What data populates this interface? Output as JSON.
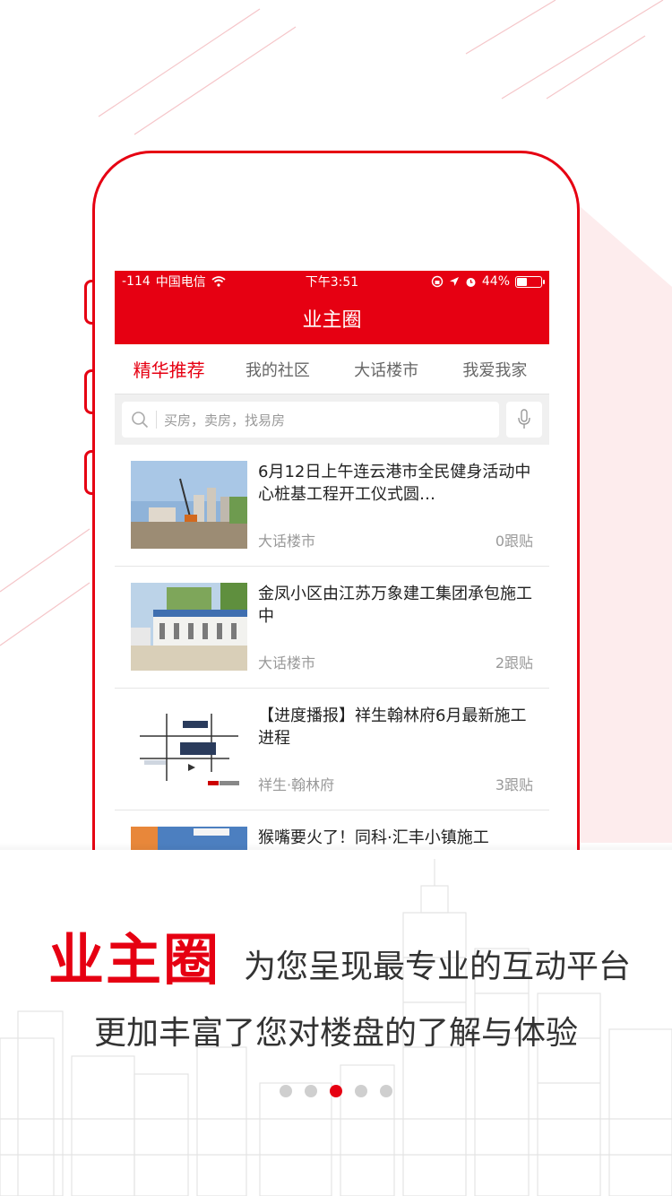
{
  "status_bar": {
    "signal": "-114",
    "carrier": "中国电信",
    "time": "下午3:51",
    "battery_percent": "44%",
    "battery_level": 0.44
  },
  "navbar": {
    "title": "业主圈"
  },
  "tabs": [
    {
      "label": "精华推荐",
      "active": true
    },
    {
      "label": "我的社区",
      "active": false
    },
    {
      "label": "大话楼市",
      "active": false
    },
    {
      "label": "我爱我家",
      "active": false
    }
  ],
  "search": {
    "placeholder": "买房，卖房，找易房"
  },
  "posts": [
    {
      "title": "6月12日上午连云港市全民健身活动中心桩基工程开工仪式圆…",
      "category": "大话楼市",
      "replies": "0跟贴"
    },
    {
      "title": "金凤小区由江苏万象建工集团承包施工中",
      "category": "大话楼市",
      "replies": "2跟贴"
    },
    {
      "title": "【进度播报】祥生翰林府6月最新施工进程",
      "category": "祥生·翰林府",
      "replies": "3跟贴"
    },
    {
      "title": "猴嘴要火了！同科·汇丰小镇施工",
      "category": "",
      "replies": ""
    }
  ],
  "promo": {
    "brand": "业主圈",
    "slogan_line1": "为您呈现最专业的互动平台",
    "slogan_line2": "更加丰富了您对楼盘的了解与体验"
  },
  "pager": {
    "count": 5,
    "active_index": 2
  },
  "colors": {
    "accent": "#e60012"
  }
}
